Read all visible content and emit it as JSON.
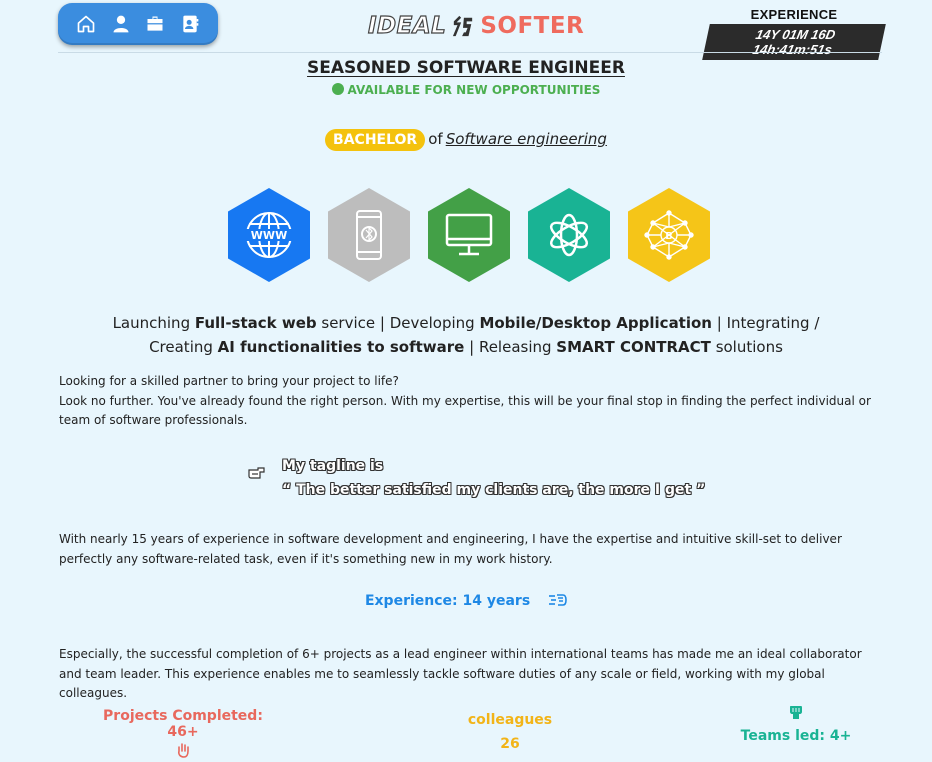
{
  "nav": {
    "items": [
      {
        "icon": "home-icon"
      },
      {
        "icon": "user-icon"
      },
      {
        "icon": "briefcase-icon"
      },
      {
        "icon": "contact-card-icon"
      }
    ]
  },
  "logo": {
    "ideal": "IDEAL",
    "softer": "SOFTER"
  },
  "experience_counter": {
    "label": "EXPERIENCE",
    "value": "14Y 01M 16D 14h:41m:51s"
  },
  "headline": {
    "title": "SEASONED SOFTWARE ENGINEER",
    "availability": "AVAILABLE FOR NEW OPPORTUNITIES"
  },
  "degree": {
    "badge": "BACHELOR",
    "of": "of",
    "field": "Software engineering"
  },
  "skills": [
    {
      "name": "web-icon",
      "color": "#1778f2"
    },
    {
      "name": "mobile-icon",
      "color": "#bdbdbd"
    },
    {
      "name": "desktop-icon",
      "color": "#43a047"
    },
    {
      "name": "ai-icon",
      "color": "#19b394"
    },
    {
      "name": "blockchain-icon",
      "color": "#f5c518"
    }
  ],
  "services": {
    "t1": "Launching ",
    "b1": "Full-stack web",
    "t2": " service | Developing ",
    "b2": "Mobile/Desktop Application",
    "t3": " | Integrating / Creating ",
    "b3": "AI functionalities to software",
    "t4": " | Releasing ",
    "b4": "SMART CONTRACT",
    "t5": " solutions"
  },
  "intro": {
    "line1": "Looking for a skilled partner to bring your project to life?",
    "line2": "Look no further. You've already found the right person. With my expertise, this will be your final stop in finding the perfect individual or team of software professionals."
  },
  "tagline": {
    "label": "My tagline is",
    "quote": "“ The better satisfied my clients are, the more I get ”"
  },
  "experience_paragraph": "With nearly 15 years of experience in software development and engineering, I have the expertise and intuitive skill-set to deliver perfectly any software-related task, even if it's something new in my work history.",
  "experience_years": "Experience: 14 years",
  "lead_paragraph": "Especially, the successful completion of 6+ projects as a lead engineer within international teams has made me an ideal collaborator and team leader. This experience enables me to seamlessly tackle software duties of any scale or field, working with my global colleagues.",
  "stats": {
    "projects": "Projects Completed: 46+",
    "colleagues_label": "colleagues",
    "colleagues_value": "26",
    "teams": "Teams led: 4+"
  },
  "colors": {
    "background": "#e8f6fd",
    "nav": "#3b8ddf",
    "accent_red": "#ef6b5e",
    "available_green": "#4caf50",
    "badge_yellow": "#f4c20d",
    "link_blue": "#1e88e5",
    "teal": "#19b394"
  }
}
